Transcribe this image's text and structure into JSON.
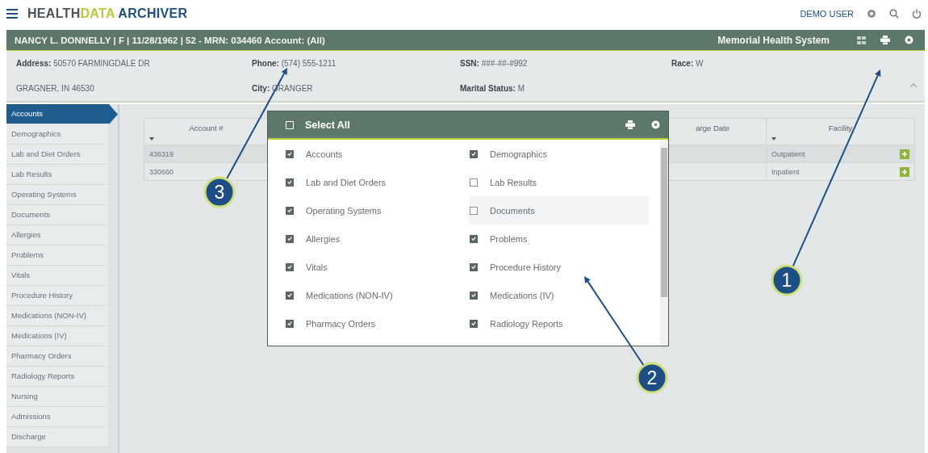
{
  "app_bar": {
    "logo": [
      {
        "text": "HEALTH",
        "kind": "dark"
      },
      {
        "text": "DATA",
        "kind": "accent"
      },
      {
        "text": " ARCHIVER",
        "kind": "brand"
      }
    ],
    "user": "DEMO USER"
  },
  "patient_bar": {
    "title": "NANCY L. DONNELLY | F | 11/28/1962 | 52 - MRN: 034460 Account: (All)",
    "organization": "Memorial Health System"
  },
  "patient_info": [
    {
      "label": "Address:",
      "value": "50570 FARMINGDALE DR"
    },
    {
      "label": "Phone:",
      "value": "(574) 555-1211"
    },
    {
      "label": "SSN:",
      "value": "###-##-#992"
    },
    {
      "label": "Race:",
      "value": "W"
    },
    {
      "value": "GRAGNER, IN 46530"
    },
    {
      "label": "City:",
      "value": "GRANGER"
    },
    {
      "label": "Marital Status:",
      "value": "M"
    }
  ],
  "sidebar": {
    "items": [
      {
        "label": "Accounts",
        "selected": true
      },
      {
        "label": "Demographics",
        "selected": false
      },
      {
        "label": "Lab and Diet Orders",
        "selected": false
      },
      {
        "label": "Lab Results",
        "selected": false
      },
      {
        "label": "Operating Systems",
        "selected": false
      },
      {
        "label": "Documents",
        "selected": false
      },
      {
        "label": "Allergies",
        "selected": false
      },
      {
        "label": "Problems",
        "selected": false
      },
      {
        "label": "Vitals",
        "selected": false
      },
      {
        "label": "Procedure History",
        "selected": false
      },
      {
        "label": "Medications (NON-IV)",
        "selected": false
      },
      {
        "label": "Medications (IV)",
        "selected": false
      },
      {
        "label": "Pharmacy Orders",
        "selected": false
      },
      {
        "label": "Radiology Reports",
        "selected": false
      },
      {
        "label": "Nursing",
        "selected": false
      },
      {
        "label": "Admissions",
        "selected": false
      },
      {
        "label": "Discharge",
        "selected": false
      }
    ]
  },
  "table": {
    "columns": [
      "Account #",
      "arge Date",
      "Facility"
    ],
    "rows": [
      {
        "account": "436319",
        "facility": "Outpatient"
      },
      {
        "account": "330660",
        "facility": "Inpatient"
      }
    ]
  },
  "print_dialog": {
    "select_all": {
      "label": "Select All",
      "checked": false
    },
    "items": [
      {
        "label": "Accounts",
        "checked": true,
        "selected": false
      },
      {
        "label": "Demographics",
        "checked": true,
        "selected": false
      },
      {
        "label": "Lab and Diet Orders",
        "checked": true,
        "selected": false
      },
      {
        "label": "Lab Results",
        "checked": false,
        "selected": false
      },
      {
        "label": "Operating Systems",
        "checked": true,
        "selected": false
      },
      {
        "label": "Documents",
        "checked": false,
        "selected": true
      },
      {
        "label": "Allergies",
        "checked": true,
        "selected": false
      },
      {
        "label": "Problems",
        "checked": true,
        "selected": false
      },
      {
        "label": "Vitals",
        "checked": true,
        "selected": false
      },
      {
        "label": "Procedure History",
        "checked": true,
        "selected": false
      },
      {
        "label": "Medications (NON-IV)",
        "checked": true,
        "selected": false
      },
      {
        "label": "Medications (IV)",
        "checked": true,
        "selected": false
      },
      {
        "label": "Pharmacy Orders",
        "checked": true,
        "selected": false
      },
      {
        "label": "Radiology Reports",
        "checked": true,
        "selected": false
      }
    ]
  },
  "callouts": [
    {
      "number": "1"
    },
    {
      "number": "2"
    },
    {
      "number": "3"
    }
  ]
}
